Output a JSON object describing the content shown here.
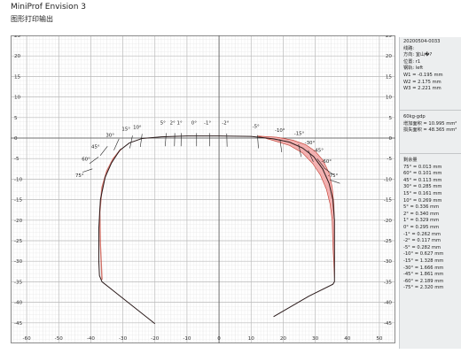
{
  "window": {
    "title": "MiniProf Envision 3",
    "subtitle": "图形打印输出"
  },
  "plot": {
    "x_range": [
      -65,
      55
    ],
    "y_range": [
      -50,
      25
    ],
    "x_ticks": [
      -60,
      -50,
      -40,
      -30,
      -20,
      -10,
      0,
      10,
      20,
      30,
      40,
      50
    ],
    "y_ticks": [
      25,
      20,
      15,
      10,
      5,
      0,
      -5,
      -10,
      -15,
      -20,
      -25,
      -30,
      -35,
      -40,
      -45
    ],
    "profile_color": "#2b1b1b",
    "wear_fill_color": "#f2b0b0",
    "wear_stroke_color": "#c0392b",
    "grid_major_color": "#b9b9b9",
    "grid_minor_color": "#e3e3e3",
    "angle_labels": [
      {
        "text": "75°",
        "x": -43.5,
        "y": -9.5
      },
      {
        "text": "60°",
        "x": -41.5,
        "y": -5.5
      },
      {
        "text": "45°",
        "x": -38.5,
        "y": -2.5
      },
      {
        "text": "30°",
        "x": -34.0,
        "y": 0.3
      },
      {
        "text": "15°",
        "x": -29.0,
        "y": 1.8
      },
      {
        "text": "10°",
        "x": -25.5,
        "y": 2.3
      },
      {
        "text": "5°",
        "x": -17.5,
        "y": 3.3
      },
      {
        "text": "2°",
        "x": -14.5,
        "y": 3.3
      },
      {
        "text": "1°",
        "x": -12.3,
        "y": 3.3
      },
      {
        "text": "0°",
        "x": -7.8,
        "y": 3.3
      },
      {
        "text": "-1°",
        "x": -3.6,
        "y": 3.3
      },
      {
        "text": "-2°",
        "x": 2.0,
        "y": 3.3
      },
      {
        "text": "-5°",
        "x": 11.5,
        "y": 2.5
      },
      {
        "text": "-10°",
        "x": 19.0,
        "y": 1.5
      },
      {
        "text": "-15°",
        "x": 25.0,
        "y": 0.8
      },
      {
        "text": "-30°",
        "x": 28.3,
        "y": -1.5
      },
      {
        "text": "-45°",
        "x": 31.0,
        "y": -3.3
      },
      {
        "text": "-60°",
        "x": 33.5,
        "y": -6.0
      },
      {
        "text": "-75°",
        "x": 35.5,
        "y": -9.5
      }
    ],
    "wear_angles": [
      {
        "deg": 75,
        "mm": 0.013
      },
      {
        "deg": 60,
        "mm": 0.101
      },
      {
        "deg": 45,
        "mm": 0.113
      },
      {
        "deg": 30,
        "mm": 0.285
      },
      {
        "deg": 15,
        "mm": 0.161
      },
      {
        "deg": 10,
        "mm": 0.269
      },
      {
        "deg": 5,
        "mm": 0.336
      },
      {
        "deg": 2,
        "mm": 0.34
      },
      {
        "deg": 1,
        "mm": 0.329
      },
      {
        "deg": 0,
        "mm": 0.295
      },
      {
        "deg": -1,
        "mm": 0.262
      },
      {
        "deg": -2,
        "mm": 0.117
      },
      {
        "deg": -5,
        "mm": 0.282
      },
      {
        "deg": -10,
        "mm": 0.627
      },
      {
        "deg": -15,
        "mm": 1.328
      },
      {
        "deg": -30,
        "mm": 1.666
      },
      {
        "deg": -45,
        "mm": 1.861
      },
      {
        "deg": -60,
        "mm": 2.189
      },
      {
        "deg": -75,
        "mm": 2.32
      }
    ]
  },
  "info": {
    "id": "20200504-0033",
    "line": "线路:",
    "direction": "方向: 宜山�?",
    "position": "位置: r1",
    "rail": "钢轨: left",
    "w1": "W1 = -0.195 mm",
    "w2": "W2 = 2.175 mm",
    "w3": "W3 = 2.221 mm",
    "rail_type": "60kg-gdp",
    "area_added": "增加面积 = 10.995 mm²",
    "area_lost": "损失面积 = 48.365 mm²",
    "remaining_title": "剩余量",
    "remaining": [
      "75° = 0.013 mm",
      "60° = 0.101 mm",
      "45° = 0.113 mm",
      "30° = 0.285 mm",
      "15° = 0.161 mm",
      "10° = 0.269 mm",
      "5° = 0.336 mm",
      "2° = 0.340 mm",
      "1° = 0.329 mm",
      "0° = 0.295 mm",
      "-1° = 0.262 mm",
      "-2° = 0.117 mm",
      "-5° = 0.282 mm",
      "-10° = 0.627 mm",
      "-15° = 1.328 mm",
      "-30° = 1.666 mm",
      "-45° = 1.861 mm",
      "-60° = 2.189 mm",
      "-75° = 2.320 mm"
    ]
  }
}
